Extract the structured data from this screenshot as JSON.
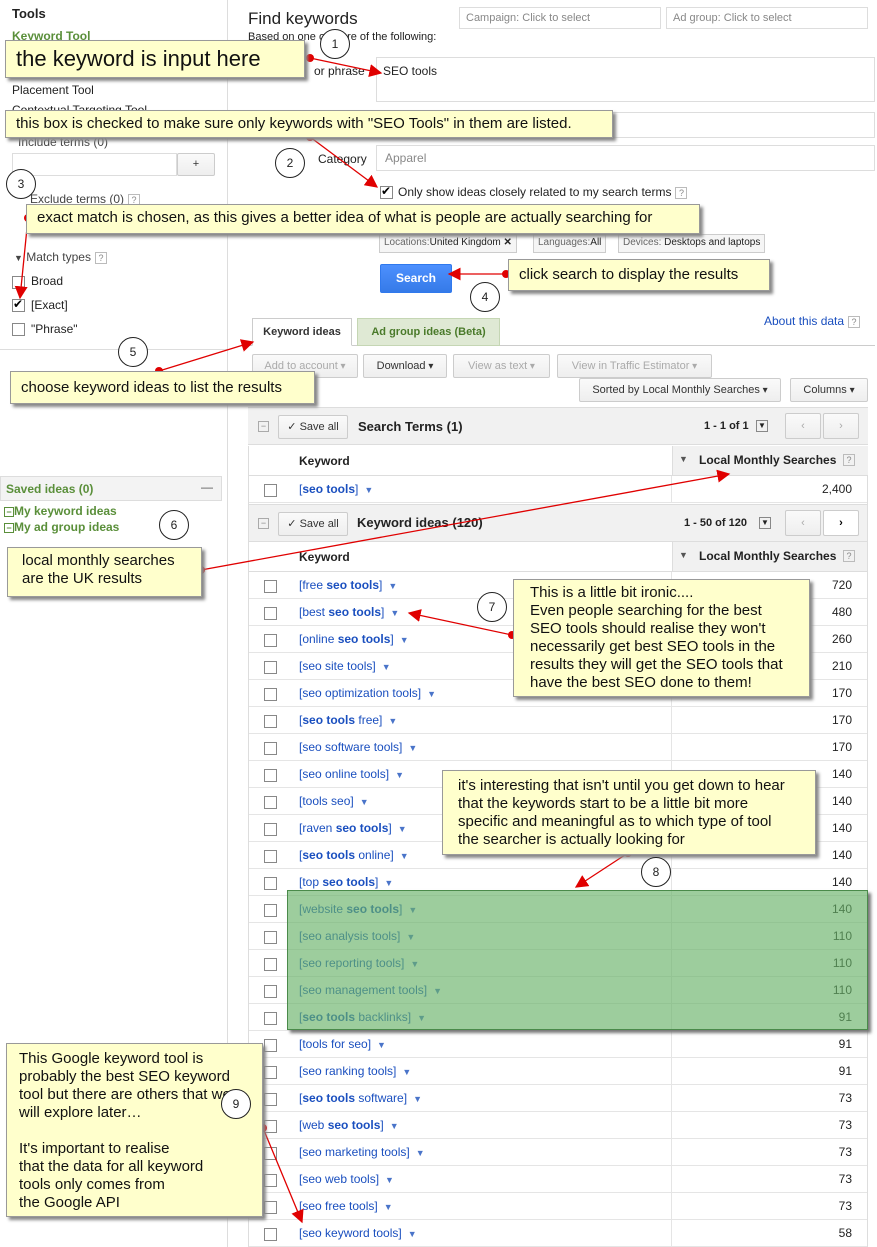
{
  "sidebar": {
    "title": "Tools",
    "tools": [
      "Keyword Tool",
      "Placement Tool",
      "Contextual Targeting Tool"
    ],
    "include_terms": "Include terms (0)",
    "plus": "+",
    "exclude_terms": "Exclude terms (0)",
    "match_types": "Match types",
    "broad": "Broad",
    "exact": "[Exact]",
    "phrase": "\"Phrase\"",
    "saved_ideas": "Saved ideas (0)",
    "minimize": "—",
    "my_keyword_ideas": "My keyword ideas",
    "my_ad_group_ideas": "My ad group ideas",
    "help": "?",
    "expand": "−"
  },
  "header": {
    "title": "Find keywords",
    "subtitle": "Based on one or more of the following:",
    "campaign_placeholder": "Campaign: Click to select",
    "adgroup_placeholder": "Ad group: Click to select",
    "phrase_label": "or phrase",
    "keyword_value": "SEO tools",
    "category_label": "Category",
    "category_value": "Apparel",
    "only_show": "Only show ideas closely related to my search terms",
    "locations": "Locations:",
    "locations_val": "United Kingdom",
    "languages": "Languages:",
    "languages_val": "All",
    "devices": "Devices:",
    "devices_val": "Desktops and laptops",
    "search_button": "Search",
    "about": "About this data"
  },
  "tabs": [
    "Keyword ideas",
    "Ad group ideas (Beta)"
  ],
  "toolbar": {
    "add_to_account": "Add to account",
    "download": "Download",
    "view_as_text": "View as text",
    "view_in_traffic": "View in Traffic Estimator",
    "sorted_by": "Sorted by Local Monthly Searches",
    "columns": "Columns"
  },
  "search_terms": {
    "save_all": "Save all",
    "title": "Search Terms (1)",
    "paging": "1 - 1 of 1",
    "col_keyword": "Keyword",
    "col_searches": "Local Monthly Searches",
    "rows": [
      {
        "pre": "[",
        "bold": "seo tools",
        "post": "]",
        "searches": "2,400"
      }
    ]
  },
  "keyword_ideas": {
    "save_all": "Save all",
    "title": "Keyword ideas (120)",
    "paging": "1 - 50 of 120",
    "col_keyword": "Keyword",
    "col_searches": "Local Monthly Searches",
    "rows": [
      {
        "pre": "[free ",
        "bold": "seo tools",
        "post": "]",
        "searches": "720"
      },
      {
        "pre": "[best ",
        "bold": "seo tools",
        "post": "]",
        "searches": "480"
      },
      {
        "pre": "[online ",
        "bold": "seo tools",
        "post": "]",
        "searches": "260"
      },
      {
        "pre": "[seo site tools]",
        "bold": "",
        "post": "",
        "searches": "210"
      },
      {
        "pre": "[seo optimization tools]",
        "bold": "",
        "post": "",
        "searches": "170"
      },
      {
        "pre": "[",
        "bold": "seo tools",
        "post": " free]",
        "searches": "170"
      },
      {
        "pre": "[seo software tools]",
        "bold": "",
        "post": "",
        "searches": "170"
      },
      {
        "pre": "[seo online tools]",
        "bold": "",
        "post": "",
        "searches": "140"
      },
      {
        "pre": "[tools seo]",
        "bold": "",
        "post": "",
        "searches": "140"
      },
      {
        "pre": "[raven ",
        "bold": "seo tools",
        "post": "]",
        "searches": "140"
      },
      {
        "pre": "[",
        "bold": "seo tools",
        "post": " online]",
        "searches": "140"
      },
      {
        "pre": "[top ",
        "bold": "seo tools",
        "post": "]",
        "searches": "140"
      },
      {
        "pre": "[website ",
        "bold": "seo tools",
        "post": "]",
        "searches": "140"
      },
      {
        "pre": "[seo analysis tools]",
        "bold": "",
        "post": "",
        "searches": "110"
      },
      {
        "pre": "[seo reporting tools]",
        "bold": "",
        "post": "",
        "searches": "110"
      },
      {
        "pre": "[seo management tools]",
        "bold": "",
        "post": "",
        "searches": "110"
      },
      {
        "pre": "[",
        "bold": "seo tools",
        "post": " backlinks]",
        "searches": "91"
      },
      {
        "pre": "[tools for seo]",
        "bold": "",
        "post": "",
        "searches": "91"
      },
      {
        "pre": "[seo ranking tools]",
        "bold": "",
        "post": "",
        "searches": "91"
      },
      {
        "pre": "[",
        "bold": "seo tools",
        "post": " software]",
        "searches": "73"
      },
      {
        "pre": "[web ",
        "bold": "seo tools",
        "post": "]",
        "searches": "73"
      },
      {
        "pre": "[seo marketing tools]",
        "bold": "",
        "post": "",
        "searches": "73"
      },
      {
        "pre": "[seo web tools]",
        "bold": "",
        "post": "",
        "searches": "73"
      },
      {
        "pre": "[seo free tools]",
        "bold": "",
        "post": "",
        "searches": "73"
      },
      {
        "pre": "[seo keyword tools]",
        "bold": "",
        "post": "",
        "searches": "58"
      }
    ]
  },
  "annotations": {
    "c1": "the keyword is input here",
    "c2": "this box is checked to make sure only keywords with \"SEO Tools\" in them are listed.",
    "c3": "exact match is chosen, as this gives a better idea of what is people are actually searching for",
    "c4": "click search to display the results",
    "c5": "choose keyword ideas to list the results",
    "c6": "local monthly searches\nare the UK results",
    "c7": "This is a little bit ironic....\nEven people searching for the best\nSEO tools should realise they won't\nnecessarily get best SEO tools in the\nresults they will get the SEO tools that\nhave the best SEO done to them!",
    "c8": "it's interesting that isn't until you get down to hear\nthat the keywords start to be a little bit more\nspecific and meaningful as to which type of tool\nthe searcher is actually looking for",
    "c9": "This Google keyword tool is\nprobably the best SEO keyword\ntool but there are others that we\nwill explore later…\n\nIt's important to realise\nthat the data for all keyword\ntools only comes from\nthe Google API",
    "n1": "1",
    "n2": "2",
    "n3": "3",
    "n4": "4",
    "n5": "5",
    "n6": "6",
    "n7": "7",
    "n8": "8",
    "n9": "9"
  },
  "colors": {
    "accent_blue": "#4d90fe",
    "link_blue": "#1a4fbf",
    "green_label": "#5a8f3a",
    "callout_bg": "#ffffcc",
    "arrow_red": "#e00000"
  }
}
